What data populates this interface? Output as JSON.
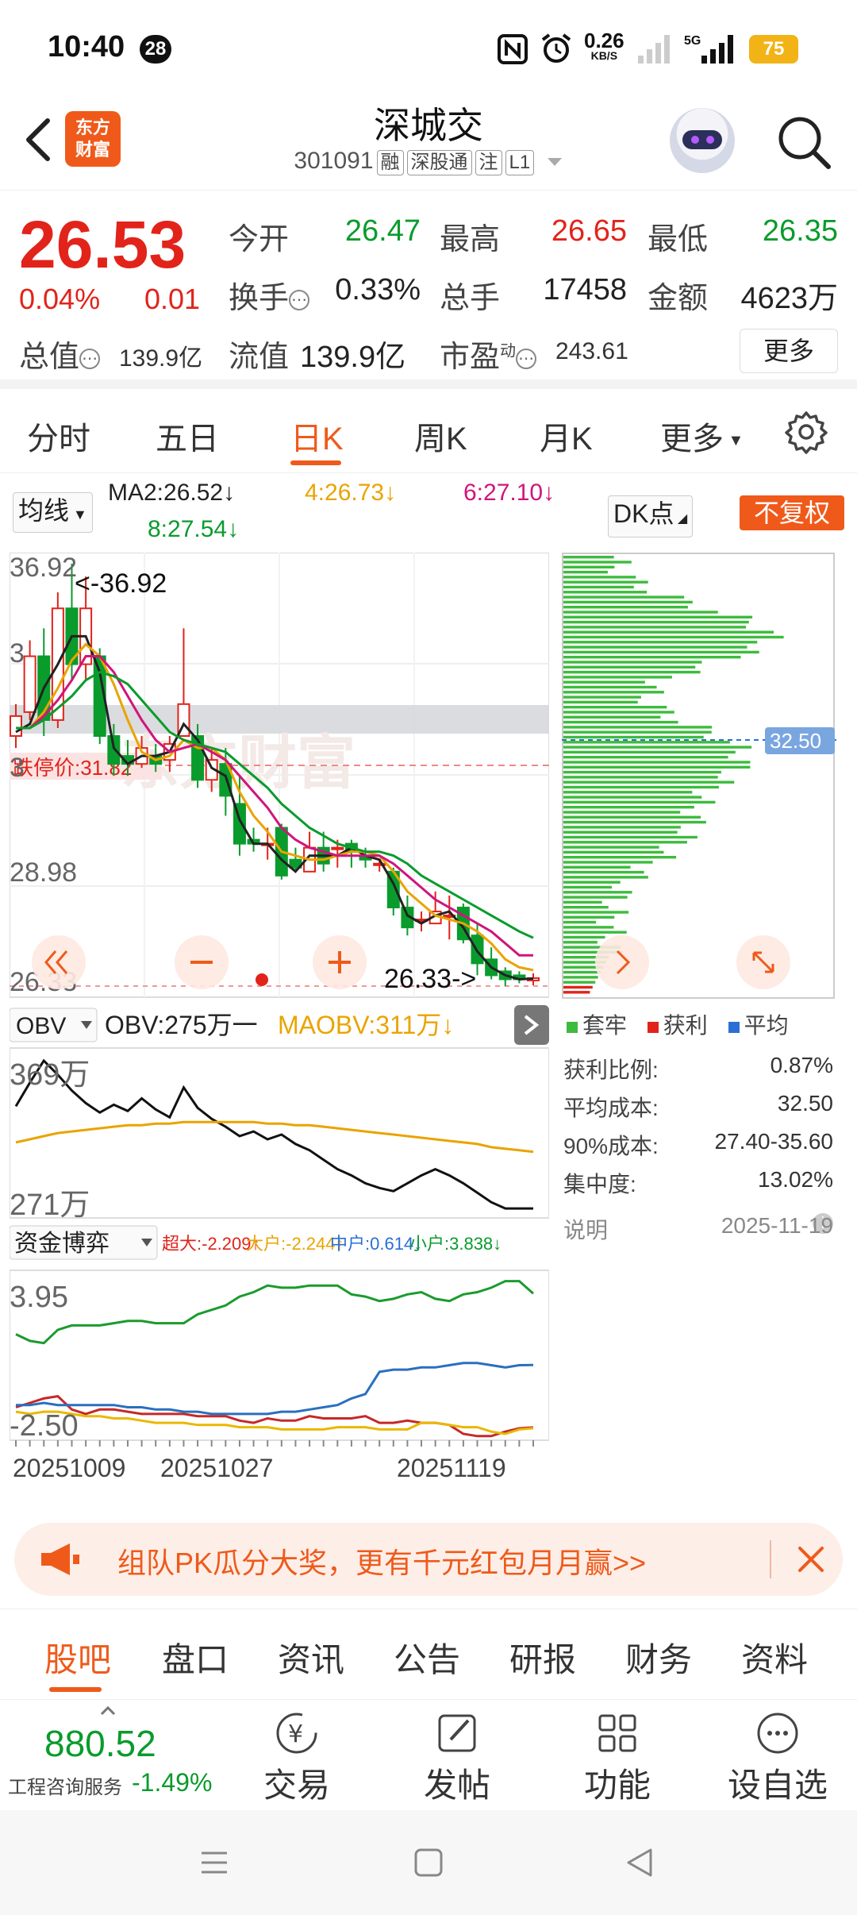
{
  "status": {
    "time": "10:40",
    "notif_count": "28",
    "net_speed": "0.26",
    "net_unit": "KB/S",
    "net_type": "5G",
    "battery": "75"
  },
  "header": {
    "stock_name": "深城交",
    "code": "301091",
    "tags": [
      "融",
      "深股通",
      "注",
      "L1"
    ],
    "logo_line1": "东方",
    "logo_line2": "财富"
  },
  "quote": {
    "price": "26.53",
    "change_pct": "0.04%",
    "change_amt": "0.01",
    "open_label": "今开",
    "open": "26.47",
    "high_label": "最高",
    "high": "26.65",
    "low_label": "最低",
    "low": "26.35",
    "turnover_label": "换手",
    "turnover": "0.33%",
    "volume_label": "总手",
    "volume": "17458",
    "amount_label": "金额",
    "amount": "4623万",
    "total_mv_label": "总值",
    "total_mv": "139.9亿",
    "float_mv_label": "流值",
    "float_mv": "139.9亿",
    "pe_label": "市盈",
    "pe_sup": "动",
    "pe": "243.61",
    "more_label": "更多"
  },
  "chart_tabs": [
    "分时",
    "五日",
    "日K",
    "周K",
    "月K",
    "更多"
  ],
  "active_chart_tab": "日K",
  "ma": {
    "selector": "均线",
    "ma2": "MA2:26.52↓",
    "ma4": "4:26.73↓",
    "ma6": "6:27.10↓",
    "ma8": "8:27.54↓",
    "dk_label": "DK点",
    "no_adjust": "不复权",
    "colors": {
      "ma2": "#222222",
      "ma4": "#e9a400",
      "ma6": "#d0157c",
      "ma8": "#0a9b2d"
    }
  },
  "kline": {
    "y_high_label": "36.92",
    "y_mid_label": "28.98",
    "y_low_label": "26.33",
    "y_label_2": "3",
    "max_annot": "<-36.92",
    "min_annot": "26.33->",
    "limit_down_label": "跌停价:31.82",
    "y_label_3": "3",
    "watermark": "东方财富"
  },
  "chart_data": [
    {
      "type": "candlestick",
      "title": "",
      "ylim": [
        26.33,
        36.92
      ],
      "candles": [
        {
          "o": 32.6,
          "c": 33.1,
          "h": 33.4,
          "l": 32.3
        },
        {
          "o": 33.2,
          "c": 34.6,
          "h": 35.0,
          "l": 33.0
        },
        {
          "o": 34.6,
          "c": 33.0,
          "h": 35.3,
          "l": 32.6
        },
        {
          "o": 33.0,
          "c": 35.8,
          "h": 36.2,
          "l": 32.8
        },
        {
          "o": 35.8,
          "c": 34.4,
          "h": 36.92,
          "l": 34.0
        },
        {
          "o": 34.4,
          "c": 35.8,
          "h": 36.6,
          "l": 34.0
        },
        {
          "o": 34.6,
          "c": 32.6,
          "h": 34.8,
          "l": 32.4
        },
        {
          "o": 32.6,
          "c": 31.9,
          "h": 32.9,
          "l": 31.6
        },
        {
          "o": 32.1,
          "c": 31.9,
          "h": 32.5,
          "l": 31.6
        },
        {
          "o": 31.9,
          "c": 32.3,
          "h": 32.6,
          "l": 31.8
        },
        {
          "o": 32.1,
          "c": 31.9,
          "h": 32.4,
          "l": 31.7
        },
        {
          "o": 32.0,
          "c": 32.4,
          "h": 32.6,
          "l": 31.7
        },
        {
          "o": 32.6,
          "c": 33.4,
          "h": 35.3,
          "l": 32.6
        },
        {
          "o": 32.6,
          "c": 31.5,
          "h": 32.9,
          "l": 31.3
        },
        {
          "o": 31.5,
          "c": 32.0,
          "h": 32.3,
          "l": 31.2
        },
        {
          "o": 31.9,
          "c": 31.1,
          "h": 32.3,
          "l": 30.6
        },
        {
          "o": 30.9,
          "c": 29.9,
          "h": 31.6,
          "l": 29.6
        },
        {
          "o": 30.0,
          "c": 29.9,
          "h": 30.3,
          "l": 29.7
        },
        {
          "o": 29.9,
          "c": 29.9,
          "h": 30.3,
          "l": 29.5
        },
        {
          "o": 30.3,
          "c": 29.1,
          "h": 30.4,
          "l": 29.0
        },
        {
          "o": 29.5,
          "c": 29.3,
          "h": 29.8,
          "l": 29.2
        },
        {
          "o": 29.2,
          "c": 29.8,
          "h": 30.2,
          "l": 29.2
        },
        {
          "o": 29.8,
          "c": 29.4,
          "h": 30.2,
          "l": 29.2
        },
        {
          "o": 29.8,
          "c": 29.8,
          "h": 30.0,
          "l": 29.3
        },
        {
          "o": 29.9,
          "c": 29.7,
          "h": 30.0,
          "l": 29.3
        },
        {
          "o": 29.6,
          "c": 29.5,
          "h": 29.8,
          "l": 29.3
        },
        {
          "o": 29.4,
          "c": 29.4,
          "h": 29.5,
          "l": 29.2
        },
        {
          "o": 29.2,
          "c": 28.3,
          "h": 29.3,
          "l": 28.1
        },
        {
          "o": 28.3,
          "c": 27.8,
          "h": 28.6,
          "l": 27.6
        },
        {
          "o": 28.0,
          "c": 28.0,
          "h": 28.2,
          "l": 27.7
        },
        {
          "o": 27.9,
          "c": 28.2,
          "h": 28.7,
          "l": 27.9
        },
        {
          "o": 28.1,
          "c": 28.1,
          "h": 28.6,
          "l": 27.5
        },
        {
          "o": 28.3,
          "c": 27.5,
          "h": 28.4,
          "l": 27.4
        },
        {
          "o": 27.6,
          "c": 26.9,
          "h": 27.9,
          "l": 26.6
        },
        {
          "o": 27.0,
          "c": 26.6,
          "h": 27.3,
          "l": 26.5
        },
        {
          "o": 26.7,
          "c": 26.5,
          "h": 26.8,
          "l": 26.33
        },
        {
          "o": 26.6,
          "c": 26.5,
          "h": 26.7,
          "l": 26.4
        },
        {
          "o": 26.47,
          "c": 26.53,
          "h": 26.65,
          "l": 26.35
        }
      ],
      "ma_series": [
        {
          "name": "MA2",
          "values": [
            32.7,
            32.9,
            33.8,
            34.4,
            35.1,
            35.1,
            34.2,
            32.3,
            31.9,
            32.1,
            32.1,
            32.2,
            32.9,
            32.5,
            31.8,
            31.6,
            30.5,
            29.9,
            29.9,
            29.5,
            29.2,
            29.6,
            29.6,
            29.6,
            29.8,
            29.6,
            29.5,
            28.9,
            28.1,
            27.9,
            28.1,
            28.2,
            27.8,
            27.2,
            26.8,
            26.6,
            26.5,
            26.52
          ]
        },
        {
          "name": "4",
          "values": [
            32.8,
            32.8,
            33.2,
            33.8,
            34.5,
            34.9,
            34.6,
            33.9,
            33.0,
            32.2,
            32.0,
            32.1,
            32.5,
            32.3,
            32.3,
            32.0,
            31.2,
            30.6,
            30.2,
            29.7,
            29.6,
            29.5,
            29.5,
            29.6,
            29.7,
            29.7,
            29.6,
            29.2,
            28.7,
            28.4,
            28.1,
            28.0,
            27.9,
            27.7,
            27.4,
            27.0,
            26.8,
            26.73
          ]
        },
        {
          "name": "6",
          "values": [
            32.8,
            32.8,
            33.1,
            33.5,
            34.0,
            34.6,
            34.6,
            34.2,
            33.6,
            33.0,
            32.5,
            32.2,
            32.3,
            32.4,
            32.2,
            32.0,
            31.6,
            31.2,
            30.8,
            30.3,
            30.0,
            29.8,
            29.7,
            29.6,
            29.6,
            29.6,
            29.6,
            29.4,
            29.1,
            28.8,
            28.5,
            28.3,
            28.1,
            27.9,
            27.7,
            27.4,
            27.1,
            27.1
          ]
        },
        {
          "name": "8",
          "values": [
            32.8,
            32.8,
            33.0,
            33.3,
            33.6,
            34.0,
            34.2,
            34.1,
            33.9,
            33.5,
            33.1,
            32.7,
            32.5,
            32.4,
            32.3,
            32.2,
            31.9,
            31.6,
            31.3,
            30.9,
            30.6,
            30.3,
            30.1,
            29.9,
            29.8,
            29.7,
            29.7,
            29.6,
            29.4,
            29.1,
            28.9,
            28.7,
            28.5,
            28.3,
            28.1,
            27.9,
            27.7,
            27.54
          ]
        }
      ]
    },
    {
      "type": "line",
      "title": "OBV",
      "ylim": [
        271,
        369
      ],
      "series": [
        {
          "name": "OBV",
          "values": [
            340,
            355,
            369,
            360,
            350,
            342,
            336,
            341,
            337,
            345,
            338,
            333,
            352,
            339,
            332,
            327,
            321,
            324,
            319,
            322,
            316,
            312,
            306,
            300,
            296,
            291,
            288,
            286,
            291,
            296,
            300,
            296,
            291,
            285,
            279,
            275,
            275,
            275
          ]
        },
        {
          "name": "MAOBV",
          "values": [
            317,
            319,
            321,
            323,
            324,
            325,
            326,
            327,
            328,
            328,
            329,
            329,
            330,
            330,
            330,
            330,
            330,
            330,
            329,
            329,
            328,
            328,
            327,
            326,
            325,
            324,
            323,
            322,
            321,
            320,
            319,
            318,
            317,
            316,
            314,
            313,
            312,
            311
          ]
        }
      ]
    },
    {
      "type": "line",
      "title": "资金博弈",
      "ylim": [
        -2.5,
        3.95
      ],
      "x_labels": [
        "20251009",
        "20251027",
        "20251119"
      ],
      "series": [
        {
          "name": "超大",
          "values": [
            -1.3,
            -1.1,
            -0.9,
            -0.8,
            -1.4,
            -1.6,
            -1.4,
            -1.4,
            -1.5,
            -1.6,
            -1.6,
            -1.6,
            -1.6,
            -1.7,
            -1.7,
            -1.7,
            -1.9,
            -2.0,
            -1.8,
            -1.9,
            -1.9,
            -1.7,
            -1.8,
            -1.8,
            -1.8,
            -1.7,
            -2.0,
            -2.0,
            -1.9,
            -2.0,
            -2.0,
            -2.1,
            -2.5,
            -2.6,
            -2.6,
            -2.4,
            -2.25,
            -2.209
          ]
        },
        {
          "name": "大户",
          "values": [
            -1.5,
            -1.6,
            -1.5,
            -1.5,
            -1.6,
            -1.7,
            -1.7,
            -1.8,
            -1.8,
            -1.9,
            -2.0,
            -2.0,
            -2.0,
            -2.1,
            -2.1,
            -2.1,
            -2.2,
            -2.2,
            -2.2,
            -2.3,
            -2.3,
            -2.3,
            -2.3,
            -2.2,
            -2.2,
            -2.2,
            -2.3,
            -2.3,
            -2.3,
            -2.0,
            -2.0,
            -2.1,
            -2.2,
            -2.2,
            -2.4,
            -2.5,
            -2.3,
            -2.244
          ]
        },
        {
          "name": "中户",
          "values": [
            -1.2,
            -1.2,
            -1.1,
            -1.2,
            -1.2,
            -1.2,
            -1.2,
            -1.2,
            -1.3,
            -1.3,
            -1.4,
            -1.4,
            -1.5,
            -1.5,
            -1.6,
            -1.6,
            -1.6,
            -1.6,
            -1.6,
            -1.5,
            -1.5,
            -1.4,
            -1.3,
            -1.2,
            -0.9,
            -0.7,
            0.3,
            0.4,
            0.4,
            0.5,
            0.5,
            0.6,
            0.7,
            0.7,
            0.6,
            0.5,
            0.6,
            0.614
          ]
        },
        {
          "name": "小户",
          "values": [
            2.0,
            1.7,
            1.6,
            2.2,
            2.4,
            2.4,
            2.4,
            2.5,
            2.6,
            2.6,
            2.5,
            2.5,
            2.5,
            2.9,
            3.1,
            3.3,
            3.7,
            3.9,
            4.2,
            4.1,
            4.1,
            4.2,
            4.2,
            4.2,
            3.8,
            3.7,
            3.5,
            3.6,
            3.8,
            3.9,
            3.6,
            3.5,
            3.8,
            3.9,
            4.1,
            4.4,
            4.4,
            3.838
          ]
        }
      ]
    }
  ],
  "obv": {
    "selector": "OBV",
    "obv_label": "OBV:275万一",
    "maobv_label": "MAOBV:311万↓",
    "y_high": "369万",
    "y_low": "271万"
  },
  "fund": {
    "selector": "资金博弈",
    "super_label": "超大:-2.209↑",
    "big_label": "大户:-2.244↑",
    "mid_label": "中户:0.614↓",
    "small_label": "小户:3.838↓",
    "y_high": "3.95",
    "y_low": "-2.50",
    "x_labels": [
      "20251009",
      "20251027",
      "20251119"
    ]
  },
  "chip": {
    "price_tag": "32.50",
    "legend": [
      "套牢",
      "获利",
      "平均"
    ],
    "legend_colors": [
      "#3dbb3d",
      "#e2231a",
      "#2a6fd6"
    ],
    "stats": [
      {
        "label": "获利比例:",
        "value": "0.87%"
      },
      {
        "label": "平均成本:",
        "value": "32.50"
      },
      {
        "label": "90%成本:",
        "value": "27.40-35.60"
      },
      {
        "label": "集中度:",
        "value": "13.02%"
      }
    ],
    "note_label": "说明",
    "date": "2025-11-19"
  },
  "banner": {
    "text": "组队PK瓜分大奖，更有千元红包月月赢>>"
  },
  "bottom_tabs": [
    "股吧",
    "盘口",
    "资讯",
    "公告",
    "研报",
    "财务",
    "资料"
  ],
  "toolbar": {
    "index_value": "880.52",
    "index_name": "工程咨询服务",
    "index_change": "-1.49%",
    "tools": [
      "交易",
      "发帖",
      "功能",
      "设自选"
    ]
  }
}
